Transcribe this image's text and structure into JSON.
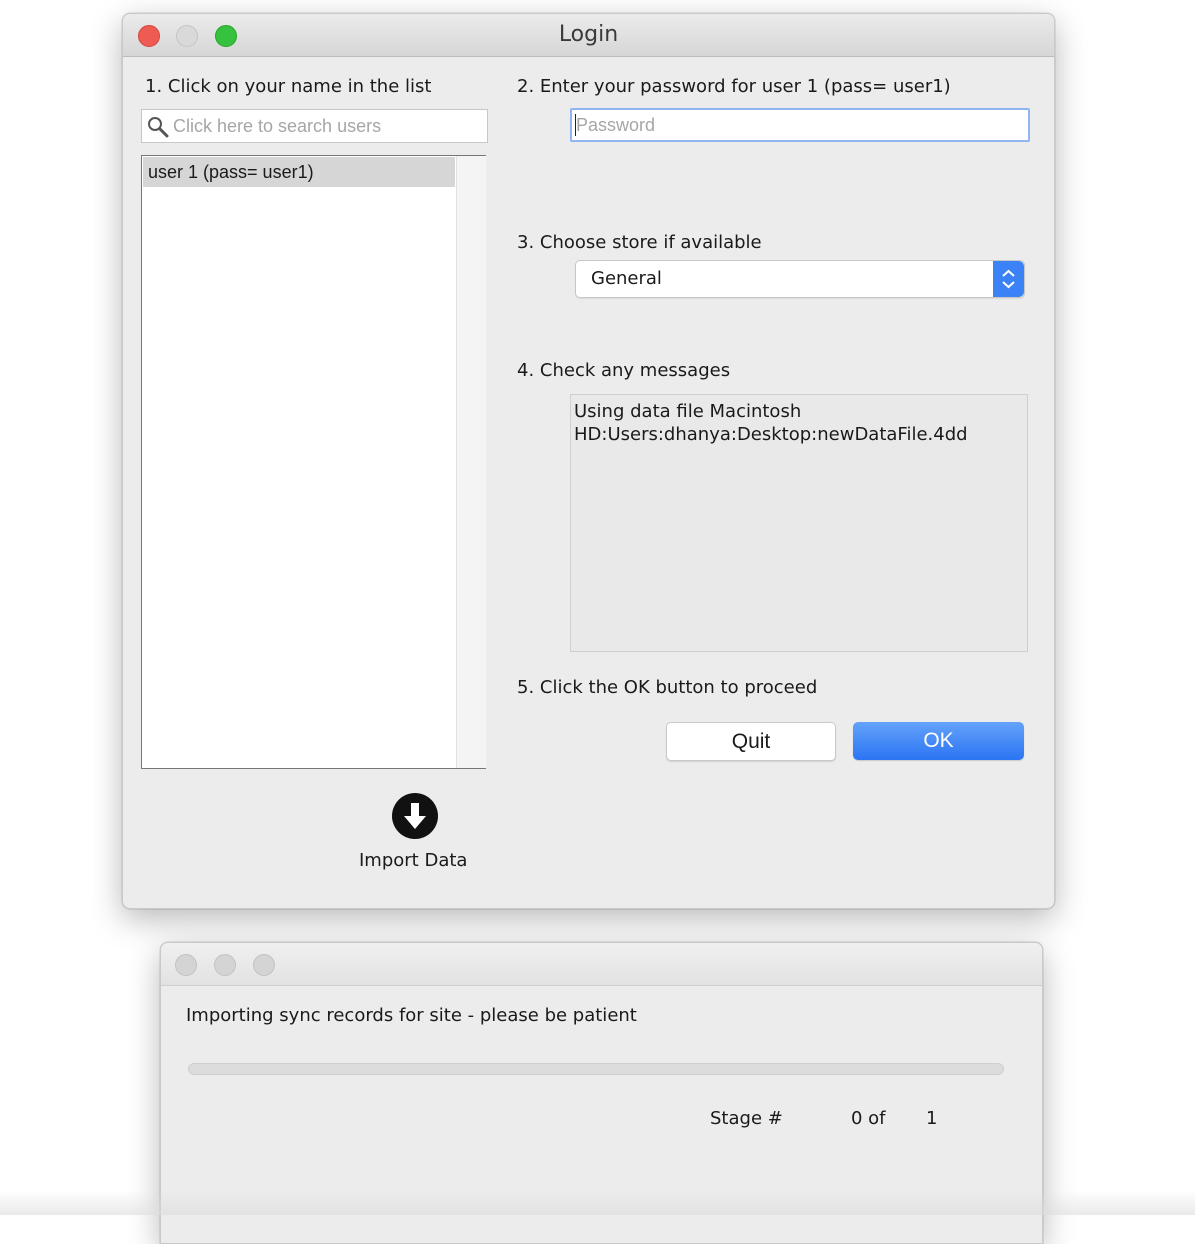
{
  "login_window": {
    "title": "Login",
    "step1": "1. Click on your name in the list",
    "search_placeholder": "Click here to search users",
    "users": [
      "user 1 (pass= user1)"
    ],
    "import_label": "Import Data",
    "step2": "2. Enter your password for user 1 (pass= user1)",
    "password_placeholder": "Password",
    "step3": "3. Choose store if available",
    "store_selected": "General",
    "step4": "4. Check any messages",
    "messages": "Using data file Macintosh\nHD:Users:dhanya:Desktop:newDataFile.4dd",
    "step5": "5. Click the OK button to proceed",
    "quit_label": "Quit",
    "ok_label": "OK"
  },
  "import_window": {
    "message": "Importing sync records for site - please be patient",
    "progress": 0,
    "stage_label": "Stage #",
    "stage_current": "0 of",
    "stage_total": "1"
  },
  "colors": {
    "close": "#ee5b52",
    "minimize_inactive": "#d9d9d9",
    "zoom": "#36c23f",
    "accent": "#2f7cf6"
  }
}
